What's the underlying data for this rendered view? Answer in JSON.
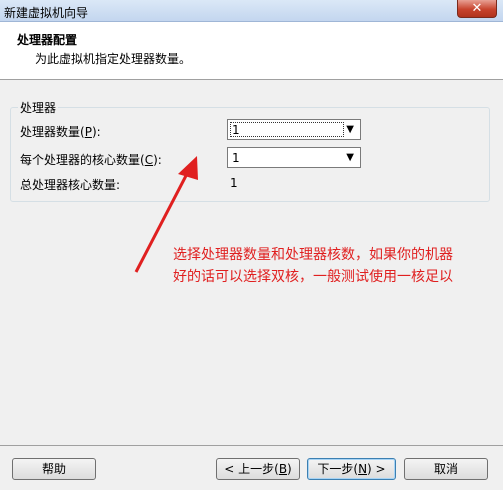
{
  "window": {
    "title": "新建虚拟机向导"
  },
  "header": {
    "title": "处理器配置",
    "subtitle": "为此虚拟机指定处理器数量。"
  },
  "processor_group": {
    "label": "处理器",
    "processor_count": {
      "label": "处理器数量(",
      "mnemonic": "P",
      "suffix": "):",
      "value": "1"
    },
    "cores_per_processor": {
      "label": "每个处理器的核心数量(",
      "mnemonic": "C",
      "suffix": "):",
      "value": "1"
    },
    "total_cores": {
      "label": "总处理器核心数量:",
      "value": "1"
    }
  },
  "annotation": {
    "line1": "选择处理器数量和处理器核数，如果你的机器",
    "line2": "好的话可以选择双核，一般测试使用一核足以",
    "color": "#e02020"
  },
  "buttons": {
    "help": "帮助",
    "back": {
      "prefix": "< 上一步(",
      "mnemonic": "B",
      "suffix": ")"
    },
    "next": {
      "prefix": "下一步(",
      "mnemonic": "N",
      "suffix": ") >"
    },
    "cancel": "取消"
  },
  "icons": {
    "close": "close-icon",
    "dropdown": "chevron-down-icon"
  }
}
